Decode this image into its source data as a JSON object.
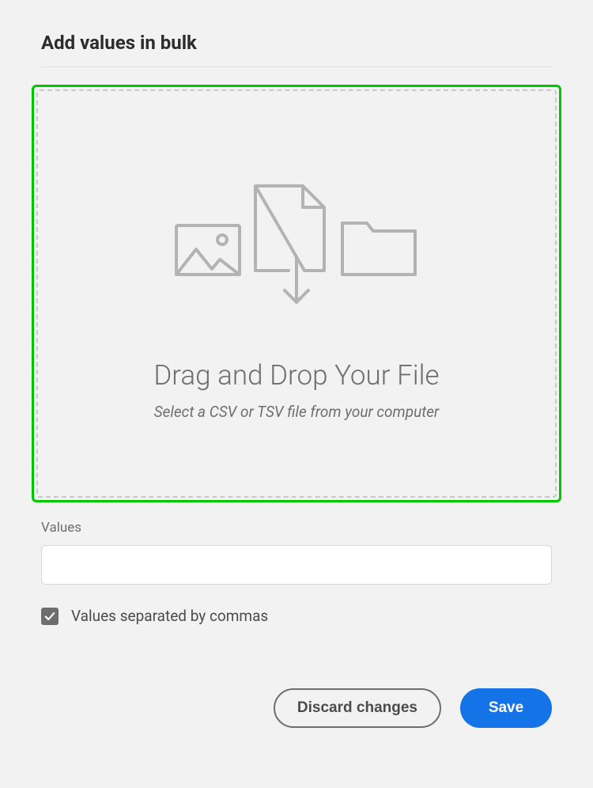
{
  "title": "Add values in bulk",
  "dropzone": {
    "headline": "Drag and Drop Your File",
    "subtext": "Select a CSV or TSV file from your computer"
  },
  "values": {
    "label": "Values",
    "input_value": "",
    "checkbox_checked": true,
    "checkbox_label": "Values separated by commas"
  },
  "buttons": {
    "discard": "Discard changes",
    "save": "Save"
  }
}
